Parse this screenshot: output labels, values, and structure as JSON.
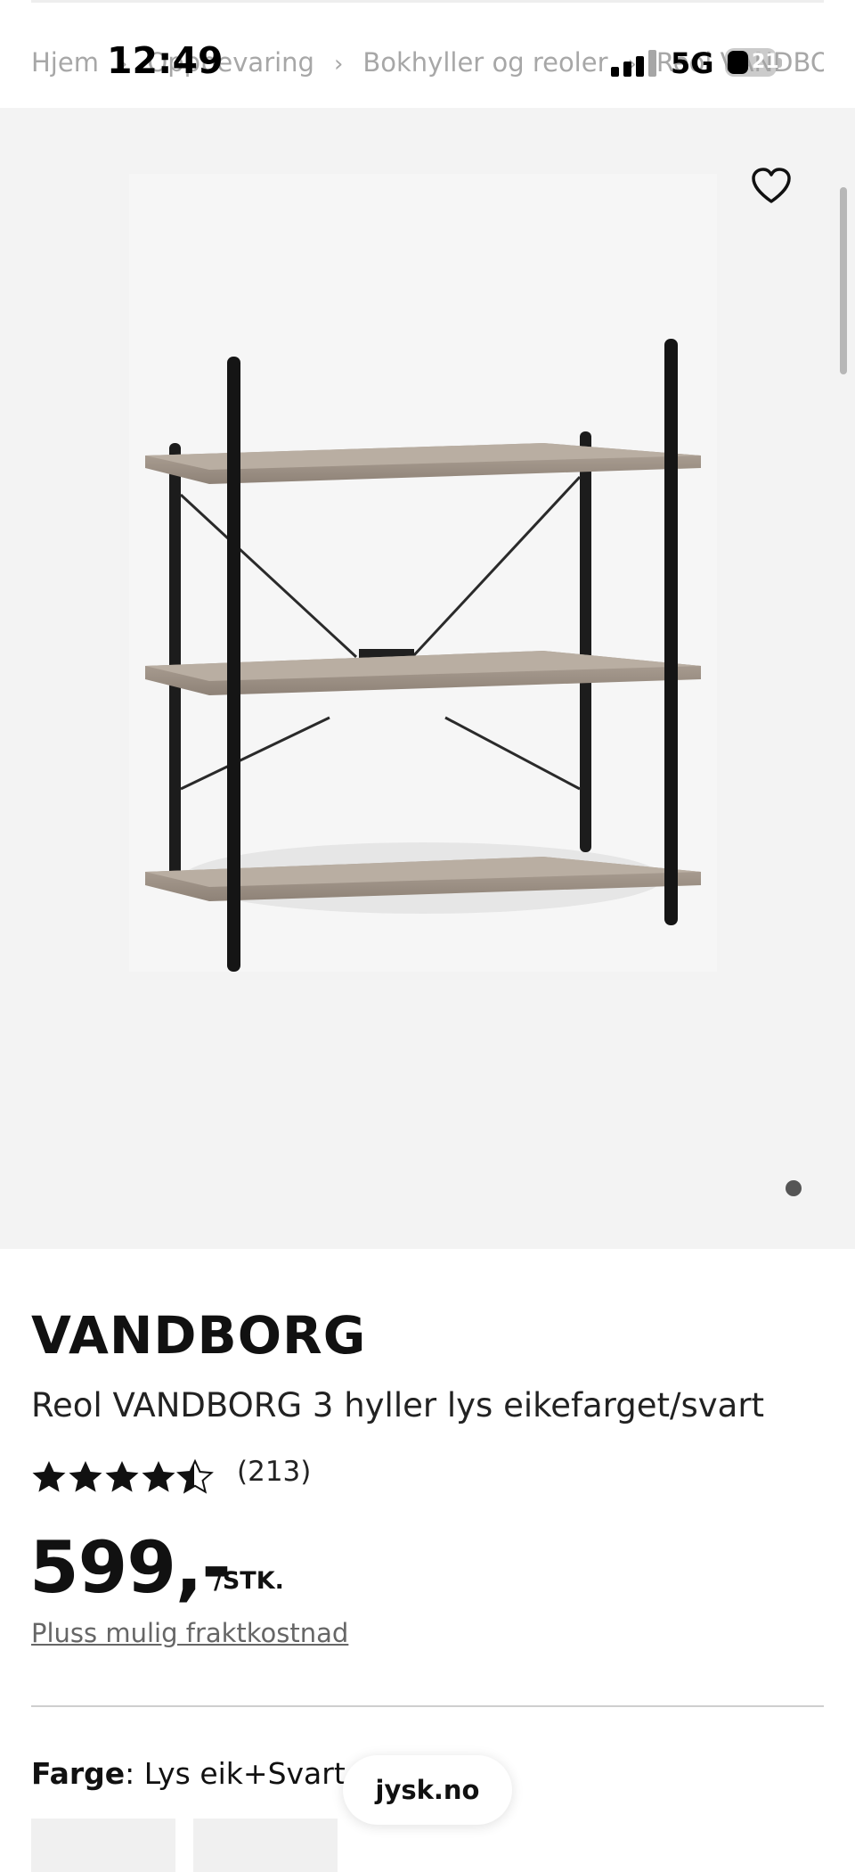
{
  "status_bar": {
    "time": "12:49",
    "network": "5G",
    "battery": "21"
  },
  "breadcrumb": {
    "items": [
      "Hjem",
      "Oppbevaring",
      "Bokhyller og reoler",
      "Reol VANDBOR"
    ]
  },
  "product": {
    "brand": "VANDBORG",
    "name": "Reol VANDBORG 3 hyller lys eikefarget/svart",
    "rating": 4.5,
    "review_count": "(213)",
    "price": "599,-",
    "price_unit": "/STK.",
    "freight_link": "Pluss mulig fraktkostnad",
    "color_label": "Farge",
    "color_value": ": Lys eik+Svart"
  },
  "gallery": {
    "image_count": 1,
    "active_index": 0
  },
  "browser": {
    "domain": "jysk.no"
  },
  "icons": {
    "favorite": "heart-icon",
    "breadcrumb_separator": "chevron-right-icon",
    "rating": "star-icon"
  }
}
